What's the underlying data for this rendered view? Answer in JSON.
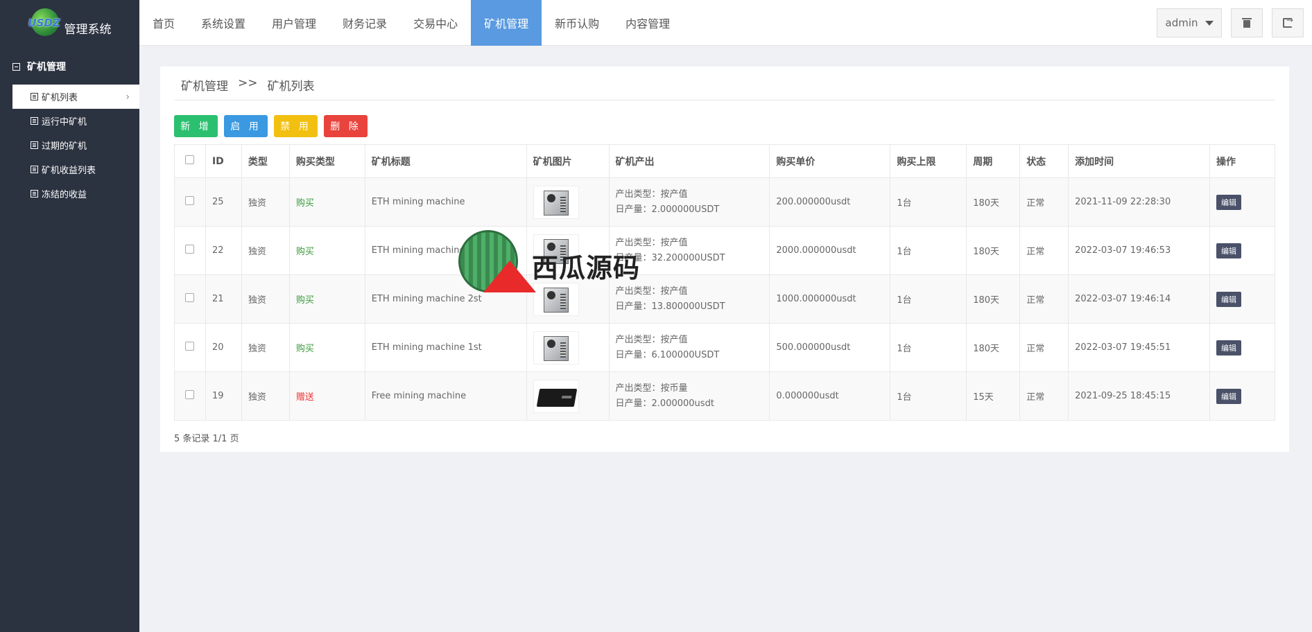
{
  "brand": {
    "logo_text": "USDZ",
    "system_name": "管理系统"
  },
  "sidebar": {
    "group_label": "矿机管理",
    "items": [
      {
        "label": "矿机列表",
        "active": true
      },
      {
        "label": "运行中矿机"
      },
      {
        "label": "过期的矿机"
      },
      {
        "label": "矿机收益列表"
      },
      {
        "label": "冻结的收益"
      }
    ]
  },
  "nav": {
    "items": [
      "首页",
      "系统设置",
      "用户管理",
      "财务记录",
      "交易中心",
      "矿机管理",
      "新币认购",
      "内容管理"
    ],
    "active_index": 5
  },
  "user": {
    "name": "admin"
  },
  "breadcrumb": {
    "parent": "矿机管理",
    "sep": ">>",
    "current": "矿机列表"
  },
  "actions": {
    "add": "新 增",
    "enable": "启 用",
    "disable": "禁 用",
    "delete": "删 除"
  },
  "table": {
    "headers": [
      "ID",
      "类型",
      "购买类型",
      "矿机标题",
      "矿机图片",
      "矿机产出",
      "购买单价",
      "购买上限",
      "周期",
      "状态",
      "添加时间",
      "操作"
    ],
    "rows": [
      {
        "id": "25",
        "type": "独资",
        "buy_type": "购买",
        "title": "ETH mining machine",
        "image": "miner-image",
        "out_type": "产出类型：按产值",
        "out_daily": "日产量：2.000000USDT",
        "price": "200.000000usdt",
        "limit": "1台",
        "cycle": "180天",
        "status": "正常",
        "time": "2021-11-09 22:28:30",
        "op": "编辑"
      },
      {
        "id": "22",
        "type": "独资",
        "buy_type": "购买",
        "title": "ETH mining machine",
        "image": "miner-image",
        "out_type": "产出类型：按产值",
        "out_daily": "日产量：32.200000USDT",
        "price": "2000.000000usdt",
        "limit": "1台",
        "cycle": "180天",
        "status": "正常",
        "time": "2022-03-07 19:46:53",
        "op": "编辑"
      },
      {
        "id": "21",
        "type": "独资",
        "buy_type": "购买",
        "title": "ETH mining machine 2st",
        "image": "miner-image",
        "out_type": "产出类型：按产值",
        "out_daily": "日产量：13.800000USDT",
        "price": "1000.000000usdt",
        "limit": "1台",
        "cycle": "180天",
        "status": "正常",
        "time": "2022-03-07 19:46:14",
        "op": "编辑"
      },
      {
        "id": "20",
        "type": "独资",
        "buy_type": "购买",
        "title": "ETH mining machine 1st",
        "image": "miner-image",
        "out_type": "产出类型：按产值",
        "out_daily": "日产量：6.100000USDT",
        "price": "500.000000usdt",
        "limit": "1台",
        "cycle": "180天",
        "status": "正常",
        "time": "2022-03-07 19:45:51",
        "op": "编辑"
      },
      {
        "id": "19",
        "type": "独资",
        "buy_type": "赠送",
        "title": "Free mining machine",
        "image": "black-box-image",
        "out_type": "产出类型：按币量",
        "out_daily": "日产量：2.000000usdt",
        "price": "0.000000usdt",
        "limit": "1台",
        "cycle": "15天",
        "status": "正常",
        "time": "2021-09-25 18:45:15",
        "op": "编辑"
      }
    ]
  },
  "pagination": {
    "text": "5 条记录 1/1 页"
  },
  "watermark": {
    "text": "西瓜源码"
  },
  "colors": {
    "sidebar_bg": "#2b3240",
    "nav_active": "#5a9ae0",
    "buy": "#3a9a3a",
    "gift": "#e33333"
  }
}
